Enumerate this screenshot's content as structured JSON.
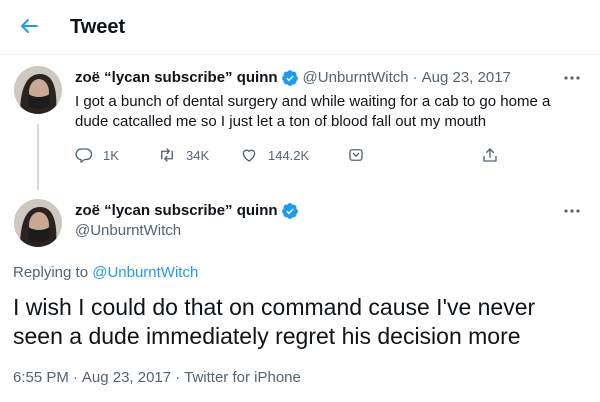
{
  "header": {
    "title": "Tweet"
  },
  "colors": {
    "accent": "#1d9bf0",
    "secondary": "#536471",
    "text": "#0f1419"
  },
  "tweet1": {
    "display_name": "zoë “lycan subscribe” quinn",
    "handle": "@UnburntWitch",
    "date": "Aug 23, 2017",
    "text": "I got a bunch of dental surgery and while waiting for a cab to go home a dude catcalled me so I just let a ton of blood fall out my mouth",
    "reply_count": "1K",
    "retweet_count": "34K",
    "like_count": "144.2K"
  },
  "tweet2": {
    "display_name": "zoë “lycan subscribe” quinn",
    "handle": "@UnburntWitch",
    "replying_prefix": "Replying to",
    "replying_handle": "@UnburntWitch",
    "text": "I wish I could do that on command cause I've never seen a dude immediately regret his decision more",
    "time": "6:55 PM",
    "date": "Aug 23, 2017",
    "source": "Twitter for iPhone"
  }
}
